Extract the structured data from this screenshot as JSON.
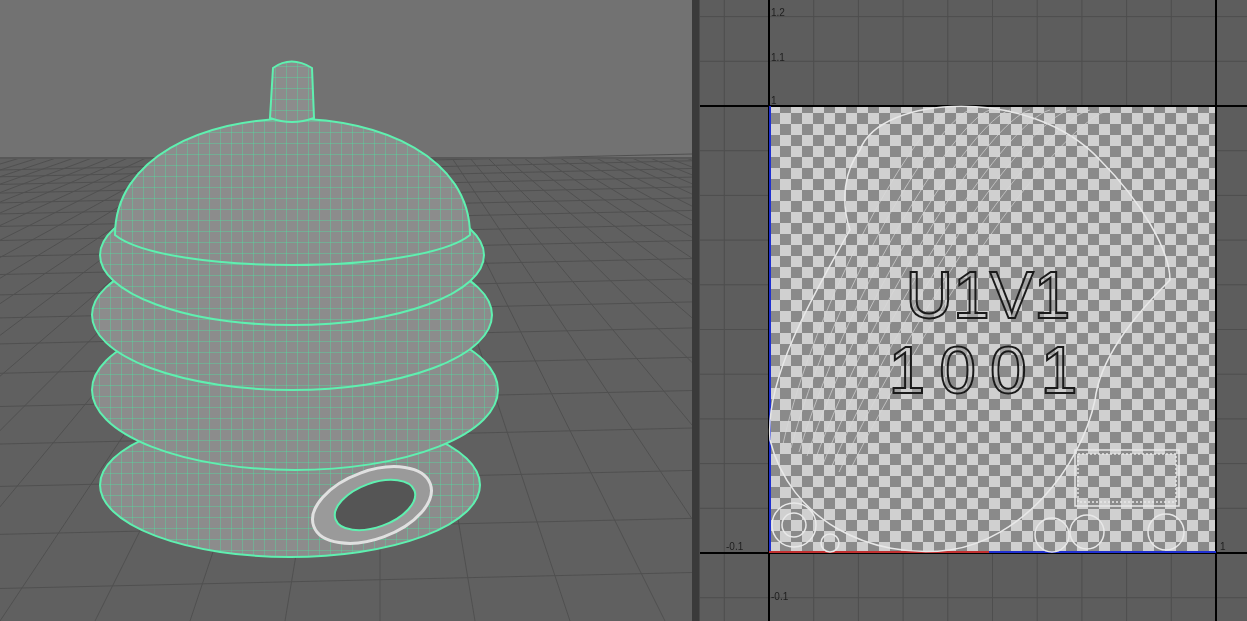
{
  "uv_editor": {
    "axis_labels": [
      {
        "text": "1.2"
      },
      {
        "text": "1.1"
      },
      {
        "text": "1"
      },
      {
        "text": "-0.1"
      },
      {
        "text": "1"
      },
      {
        "text": "-0.1"
      }
    ],
    "tile_labels": [
      {
        "text": "U1V1"
      },
      {
        "text": "1001"
      }
    ]
  }
}
